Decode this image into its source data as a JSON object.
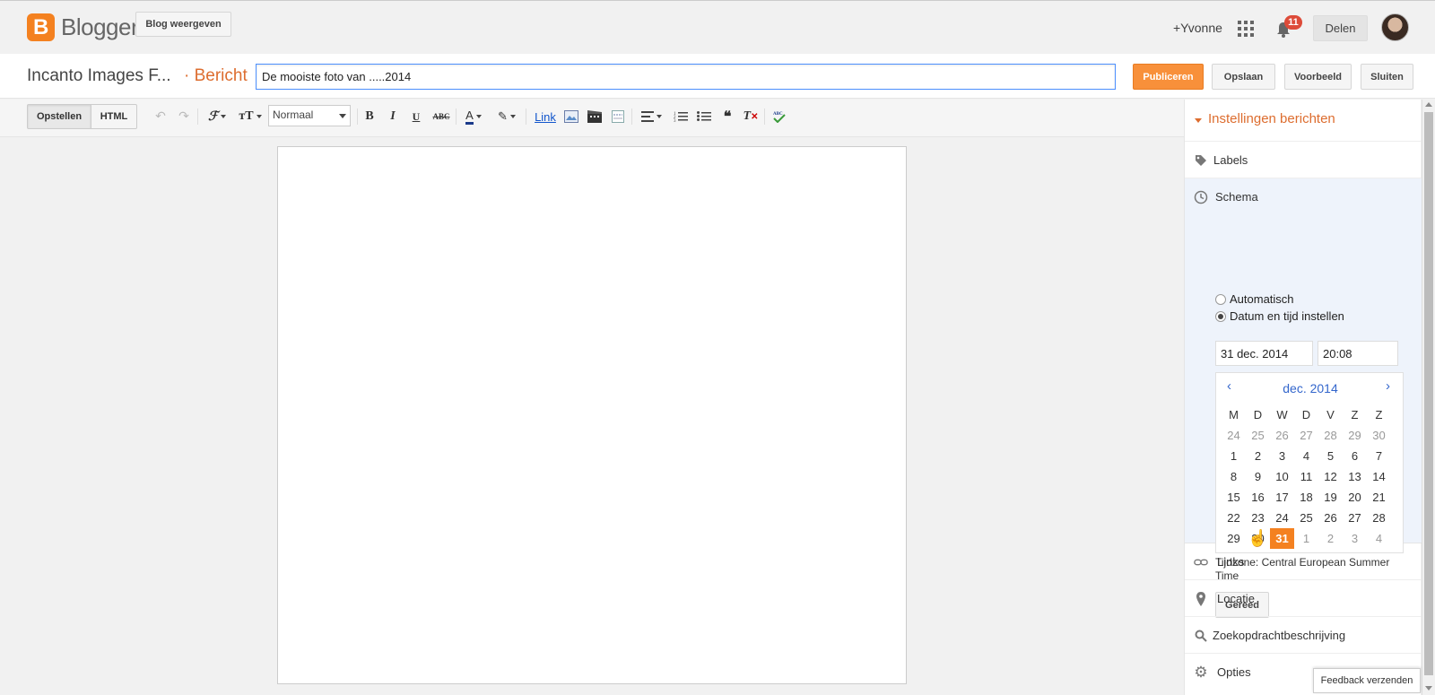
{
  "topbar": {
    "logo_letter": "B",
    "logo_text": "Blogger",
    "view_blog": "Blog weergeven",
    "user": "+Yvonne",
    "notifications": "11",
    "share": "Delen"
  },
  "header": {
    "blog_name": "Incanto Images F...",
    "separator": "·",
    "post_label": "Bericht",
    "title_value": "De mooiste foto van .....2014",
    "publish": "Publiceren",
    "save": "Opslaan",
    "preview": "Voorbeeld",
    "close": "Sluiten"
  },
  "toolbar": {
    "compose": "Opstellen",
    "html": "HTML",
    "font_size": "Normaal",
    "bold": "B",
    "italic": "I",
    "underline": "U",
    "strike": "ABC",
    "link": "Link"
  },
  "sidebar": {
    "title": "Instellingen berichten",
    "labels": "Labels",
    "schedule": "Schema",
    "radio_auto": "Automatisch",
    "radio_manual": "Datum en tijd instellen",
    "date_value": "31 dec. 2014",
    "time_value": "20:08",
    "timezone": "Tijdzone: Central European Summer Time",
    "done": "Gereed",
    "links": "Links",
    "location": "Locatie",
    "search_desc": "Zoekopdrachtbeschrijving",
    "options": "Opties"
  },
  "calendar": {
    "prev": "‹",
    "next": "›",
    "month": "dec. 2014",
    "weekdays": [
      "M",
      "D",
      "W",
      "D",
      "V",
      "Z",
      "Z"
    ],
    "weeks": [
      [
        "24",
        "25",
        "26",
        "27",
        "28",
        "29",
        "30"
      ],
      [
        "1",
        "2",
        "3",
        "4",
        "5",
        "6",
        "7"
      ],
      [
        "8",
        "9",
        "10",
        "11",
        "12",
        "13",
        "14"
      ],
      [
        "15",
        "16",
        "17",
        "18",
        "19",
        "20",
        "21"
      ],
      [
        "22",
        "23",
        "24",
        "25",
        "26",
        "27",
        "28"
      ],
      [
        "29",
        "30",
        "31",
        "1",
        "2",
        "3",
        "4"
      ]
    ],
    "selected_day": "31"
  },
  "feedback": "Feedback verzenden",
  "colors": {
    "accent": "#f48120",
    "link": "#3366cc",
    "schedule_bg": "#eef3fb"
  }
}
